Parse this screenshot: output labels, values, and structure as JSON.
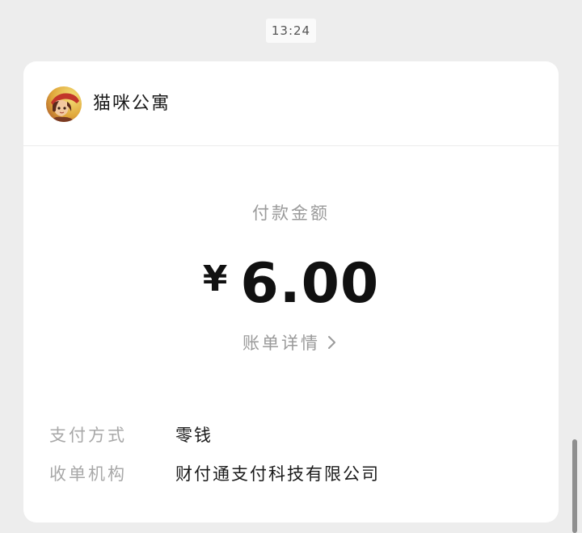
{
  "time": "13:24",
  "merchant": {
    "name": "猫咪公寓",
    "avatar_icon": "avatar-cartoon-girl"
  },
  "payment": {
    "amount_label": "付款金额",
    "currency_symbol": "¥",
    "amount": "6.00",
    "detail_link": "账单详情"
  },
  "info": [
    {
      "label": "支付方式",
      "value": "零钱"
    },
    {
      "label": "收单机构",
      "value": "财付通支付科技有限公司"
    }
  ]
}
